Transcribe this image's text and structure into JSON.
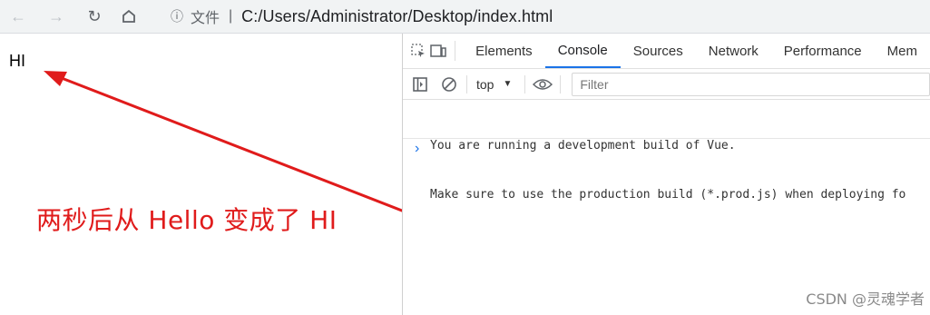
{
  "browser": {
    "back_icon": "arrow-left-icon",
    "forward_icon": "arrow-right-icon",
    "reload_icon": "reload-icon",
    "home_icon": "home-icon",
    "info_icon": "info-icon",
    "protocol_label": "文件",
    "url": "C:/Users/Administrator/Desktop/index.html"
  },
  "page": {
    "hi_text": "HI",
    "annotation": "两秒后从 Hello 变成了 HI",
    "annotation_color": "#e01b1b"
  },
  "devtools": {
    "tabs": [
      "Elements",
      "Console",
      "Sources",
      "Network",
      "Performance",
      "Mem"
    ],
    "active_tab": "Console",
    "context": "top",
    "filter_placeholder": "Filter",
    "console_lines": [
      "You are running a development build of Vue.",
      "Make sure to use the production build (*.prod.js) when deploying fo"
    ],
    "prompt_symbol": "›",
    "accent": "#1a73e8"
  },
  "watermark": "CSDN @灵魂学者"
}
